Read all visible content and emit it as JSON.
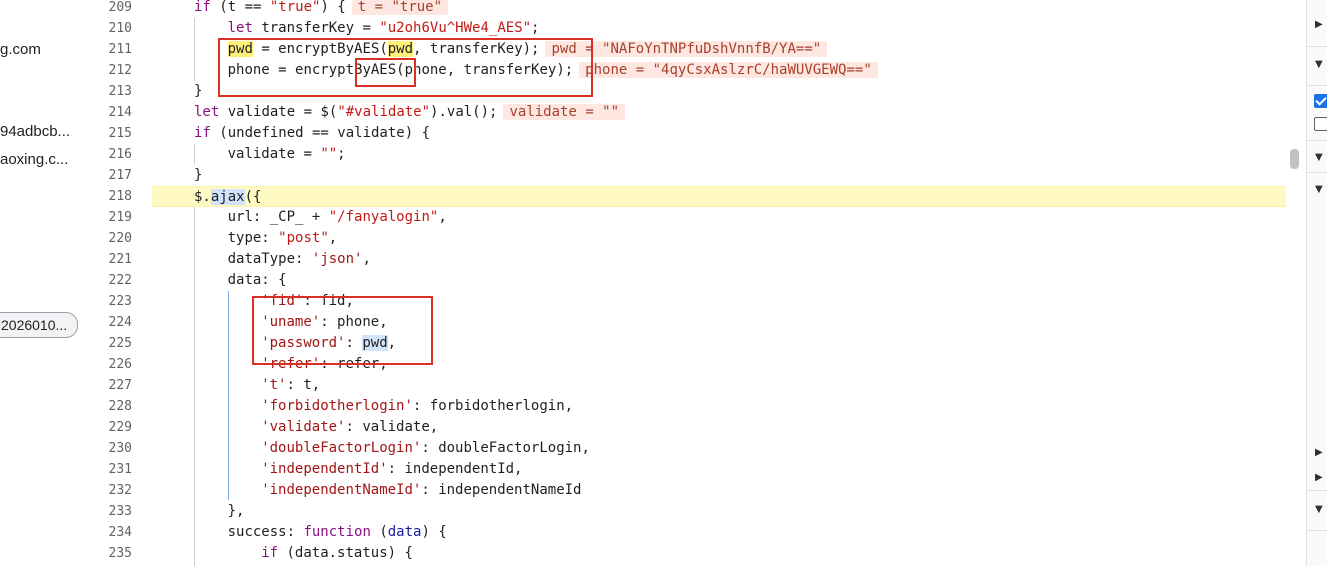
{
  "left_panel": {
    "items": [
      "g.com",
      "94adbcb...",
      "aoxing.c..."
    ],
    "chip": "2026010..."
  },
  "editor": {
    "lines": [
      {
        "n": "209",
        "indent": 1,
        "tokens": [
          [
            "kw",
            "if"
          ],
          [
            "p",
            " (t == "
          ],
          [
            "str",
            "\"true\""
          ],
          [
            "p",
            ") {"
          ]
        ],
        "inline": "t = \"true\""
      },
      {
        "n": "210",
        "indent": 2,
        "tokens": [
          [
            "kw",
            "let"
          ],
          [
            "p",
            " transferKey = "
          ],
          [
            "str",
            "\"u2oh6Vu^HWe4_AES\""
          ],
          [
            "p",
            ";"
          ]
        ]
      },
      {
        "n": "211",
        "indent": 2,
        "tokens": [
          [
            "mark-y",
            "pwd"
          ],
          [
            "p",
            " = encryptByAES("
          ],
          [
            "mark-y",
            "pwd"
          ],
          [
            "p",
            ", transferKey);"
          ]
        ],
        "inline": "pwd = \"NAFoYnTNPfuDshVnnfB/YA==\""
      },
      {
        "n": "212",
        "indent": 2,
        "tokens": [
          [
            "p",
            "phone = encryptByAES(phone, transferKey);"
          ]
        ],
        "inline": "phone = \"4qyCsxAslzrC/haWUVGEWQ==\""
      },
      {
        "n": "213",
        "indent": 1,
        "tokens": [
          [
            "p",
            "}"
          ]
        ]
      },
      {
        "n": "214",
        "indent": 1,
        "tokens": [
          [
            "kw",
            "let"
          ],
          [
            "p",
            " validate = $("
          ],
          [
            "str",
            "\"#validate\""
          ],
          [
            "p",
            ").val();"
          ]
        ],
        "inline": "validate = \"\""
      },
      {
        "n": "215",
        "indent": 1,
        "tokens": [
          [
            "kw",
            "if"
          ],
          [
            "p",
            " (undefined == validate) {"
          ]
        ]
      },
      {
        "n": "216",
        "indent": 2,
        "tokens": [
          [
            "p",
            "validate = "
          ],
          [
            "str",
            "\"\""
          ],
          [
            "p",
            ";"
          ]
        ]
      },
      {
        "n": "217",
        "indent": 1,
        "tokens": [
          [
            "p",
            "}"
          ]
        ]
      },
      {
        "n": "218",
        "indent": 1,
        "hl": true,
        "tokens": [
          [
            "p",
            "$."
          ],
          [
            "mark-b",
            "ajax"
          ],
          [
            "p",
            "({"
          ]
        ]
      },
      {
        "n": "219",
        "indent": 2,
        "tokens": [
          [
            "p",
            "url: _CP_ + "
          ],
          [
            "str",
            "\"/fanyalogin\""
          ],
          [
            "p",
            ","
          ]
        ]
      },
      {
        "n": "220",
        "indent": 2,
        "tokens": [
          [
            "p",
            "type: "
          ],
          [
            "str",
            "\"post\""
          ],
          [
            "p",
            ","
          ]
        ]
      },
      {
        "n": "221",
        "indent": 2,
        "tokens": [
          [
            "p",
            "dataType: "
          ],
          [
            "sq",
            "'json'"
          ],
          [
            "p",
            ","
          ]
        ]
      },
      {
        "n": "222",
        "indent": 2,
        "tokens": [
          [
            "p",
            "data: {"
          ]
        ]
      },
      {
        "n": "223",
        "indent": 3,
        "tokens": [
          [
            "sq",
            "'fid'"
          ],
          [
            "p",
            ": fid,"
          ]
        ]
      },
      {
        "n": "224",
        "indent": 3,
        "tokens": [
          [
            "sq",
            "'uname'"
          ],
          [
            "p",
            ": phone,"
          ]
        ]
      },
      {
        "n": "225",
        "indent": 3,
        "tokens": [
          [
            "sq",
            "'password'"
          ],
          [
            "p",
            ": "
          ],
          [
            "mark-b",
            "pwd"
          ],
          [
            "p",
            ","
          ]
        ]
      },
      {
        "n": "226",
        "indent": 3,
        "tokens": [
          [
            "sq",
            "'refer'"
          ],
          [
            "p",
            ": refer,"
          ]
        ]
      },
      {
        "n": "227",
        "indent": 3,
        "tokens": [
          [
            "sq",
            "'t'"
          ],
          [
            "p",
            ": t,"
          ]
        ]
      },
      {
        "n": "228",
        "indent": 3,
        "tokens": [
          [
            "sq",
            "'forbidotherlogin'"
          ],
          [
            "p",
            ": forbidotherlogin,"
          ]
        ]
      },
      {
        "n": "229",
        "indent": 3,
        "tokens": [
          [
            "sq",
            "'validate'"
          ],
          [
            "p",
            ": validate,"
          ]
        ]
      },
      {
        "n": "230",
        "indent": 3,
        "tokens": [
          [
            "sq",
            "'doubleFactorLogin'"
          ],
          [
            "p",
            ": doubleFactorLogin,"
          ]
        ]
      },
      {
        "n": "231",
        "indent": 3,
        "tokens": [
          [
            "sq",
            "'independentId'"
          ],
          [
            "p",
            ": independentId,"
          ]
        ]
      },
      {
        "n": "232",
        "indent": 3,
        "tokens": [
          [
            "sq",
            "'independentNameId'"
          ],
          [
            "p",
            ": independentNameId"
          ]
        ]
      },
      {
        "n": "233",
        "indent": 2,
        "tokens": [
          [
            "p",
            "},"
          ]
        ]
      },
      {
        "n": "234",
        "indent": 2,
        "tokens": [
          [
            "p",
            "success: "
          ],
          [
            "kw",
            "function"
          ],
          [
            "p",
            " ("
          ],
          [
            "kw2",
            "data"
          ],
          [
            "p",
            ") {"
          ]
        ]
      },
      {
        "n": "235",
        "indent": 3,
        "tokens": [
          [
            "kw",
            "if"
          ],
          [
            "p",
            " (data.status) {"
          ]
        ]
      }
    ]
  },
  "right_panel": {
    "icons": [
      "triangle-right-icon",
      "triangle-down-icon",
      "checkbox-checked",
      "checkbox-empty",
      "triangle-down-icon",
      "triangle-down-icon",
      "triangle-right-icon",
      "triangle-right-icon",
      "triangle-right-icon",
      "triangle-down-icon"
    ]
  },
  "colors": {
    "highlight_line": "#fff9c4",
    "annotation_box": "#d93025",
    "inline_value_bg": "#fde7e0"
  }
}
